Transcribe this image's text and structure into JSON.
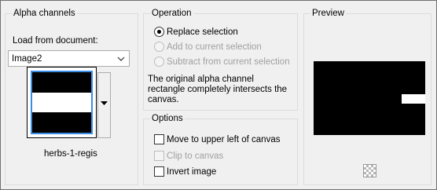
{
  "alpha_channels": {
    "title": "Alpha channels",
    "load_label": "Load from document:",
    "document_selected": "Image2",
    "channel_name": "herbs-1-regis"
  },
  "operation": {
    "title": "Operation",
    "replace": "Replace selection",
    "add": "Add to current selection",
    "subtract": "Subtract from current selection",
    "description": "The original alpha channel rectangle completely intersects the canvas.",
    "description_lines": [
      "The original alpha channel",
      "rectangle completely intersects the",
      "canvas."
    ],
    "selected": "replace"
  },
  "options": {
    "title": "Options",
    "move_to_upper_left": "Move to upper left of canvas",
    "clip_to_canvas": "Clip to canvas",
    "invert_image": "Invert image",
    "move_checked": false,
    "clip_checked": false,
    "invert_checked": false
  },
  "preview": {
    "title": "Preview"
  },
  "colors": {
    "accent": "#3a8ee6",
    "disabled_text": "#a0a0a0"
  }
}
